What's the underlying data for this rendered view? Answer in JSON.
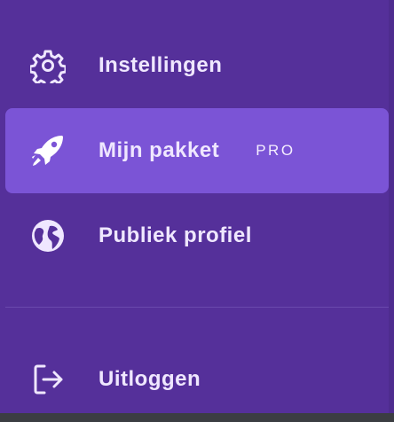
{
  "menu": {
    "items": [
      {
        "label": "Instellingen",
        "icon": "gear-icon"
      },
      {
        "label": "Mijn pakket",
        "icon": "rocket-icon",
        "badge": "PRO",
        "active": true
      },
      {
        "label": "Publiek profiel",
        "icon": "globe-icon"
      },
      {
        "label": "Uitloggen",
        "icon": "logout-icon"
      }
    ]
  },
  "colors": {
    "background": "#55309a",
    "active_background": "#7b54d6",
    "text": "#efe7ff",
    "divider": "#6a49ad"
  }
}
